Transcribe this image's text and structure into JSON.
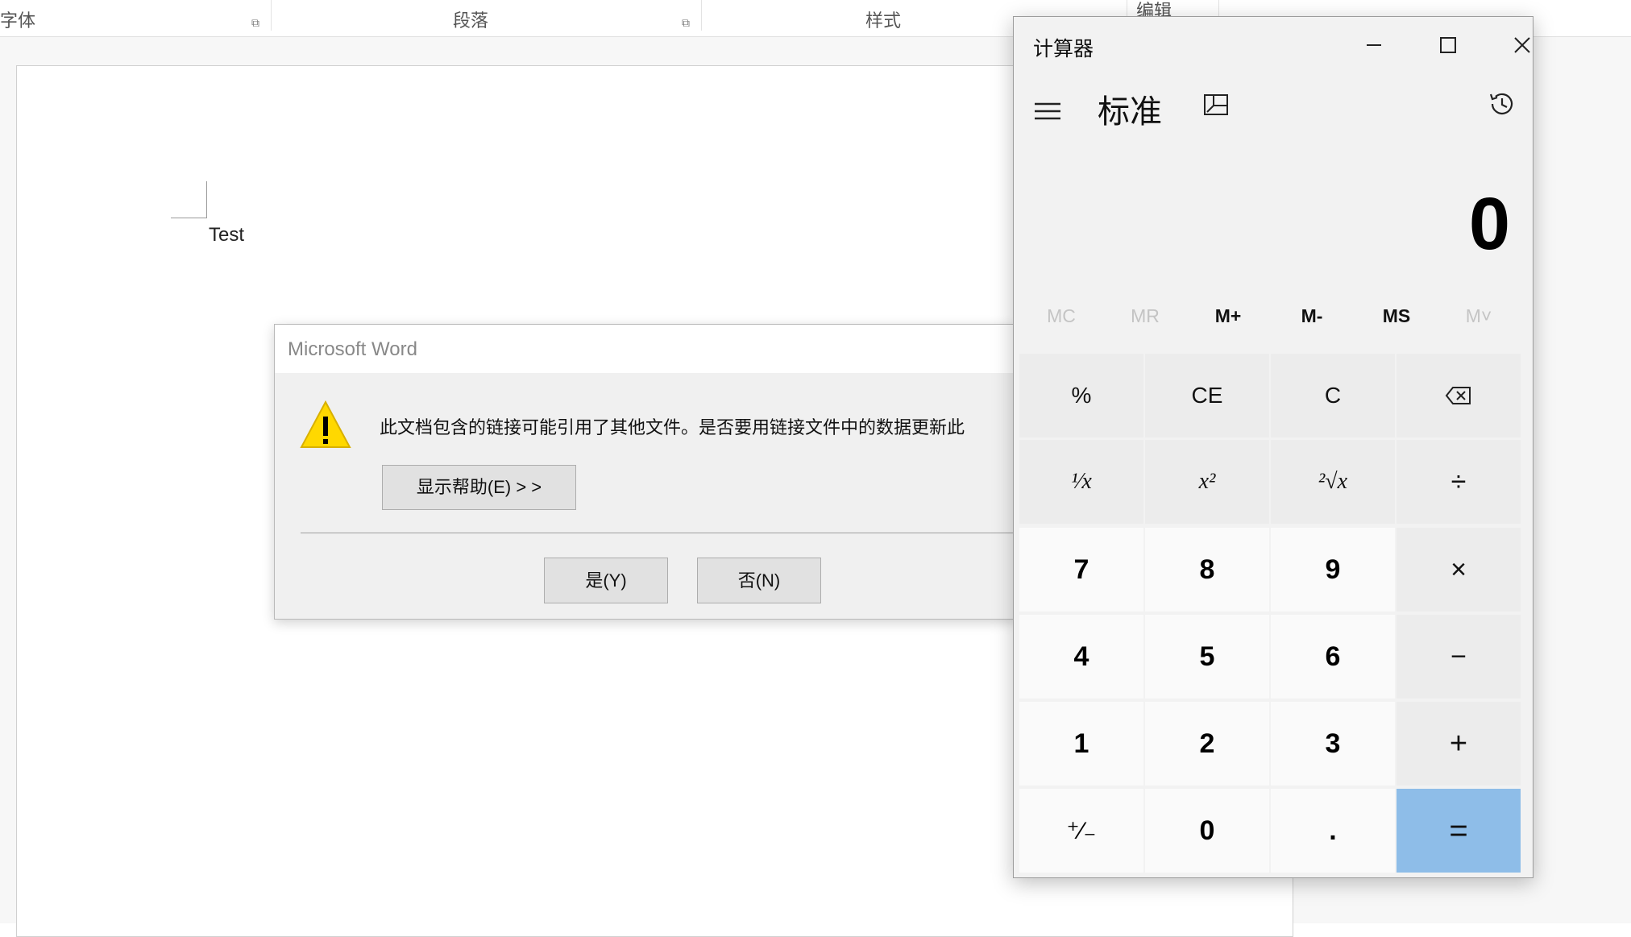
{
  "word": {
    "ribbon_groups": [
      "字体",
      "段落",
      "样式",
      "编辑"
    ],
    "document_text": "Test",
    "dialog": {
      "title": "Microsoft Word",
      "message": "此文档包含的链接可能引用了其他文件。是否要用链接文件中的数据更新此",
      "help_button": "显示帮助(E) > >",
      "yes_button": "是(Y)",
      "no_button": "否(N)",
      "icon": "warning-icon"
    }
  },
  "calculator": {
    "title": "计算器",
    "mode": "标准",
    "display": "0",
    "memory": [
      {
        "label": "MC",
        "enabled": false
      },
      {
        "label": "MR",
        "enabled": false
      },
      {
        "label": "M+",
        "enabled": true
      },
      {
        "label": "M-",
        "enabled": true
      },
      {
        "label": "MS",
        "enabled": true
      },
      {
        "label": "M˅",
        "enabled": false
      }
    ],
    "keys": [
      [
        "%",
        "CE",
        "C",
        "⌫"
      ],
      [
        "¹⁄x",
        "x²",
        "²√x",
        "÷"
      ],
      [
        "7",
        "8",
        "9",
        "×"
      ],
      [
        "4",
        "5",
        "6",
        "−"
      ],
      [
        "1",
        "2",
        "3",
        "+"
      ],
      [
        "⁺⁄₋",
        "0",
        ".",
        "="
      ]
    ],
    "colors": {
      "equals": "#8ebde8",
      "number_key": "#fafafa",
      "function_key": "#ececec"
    }
  }
}
